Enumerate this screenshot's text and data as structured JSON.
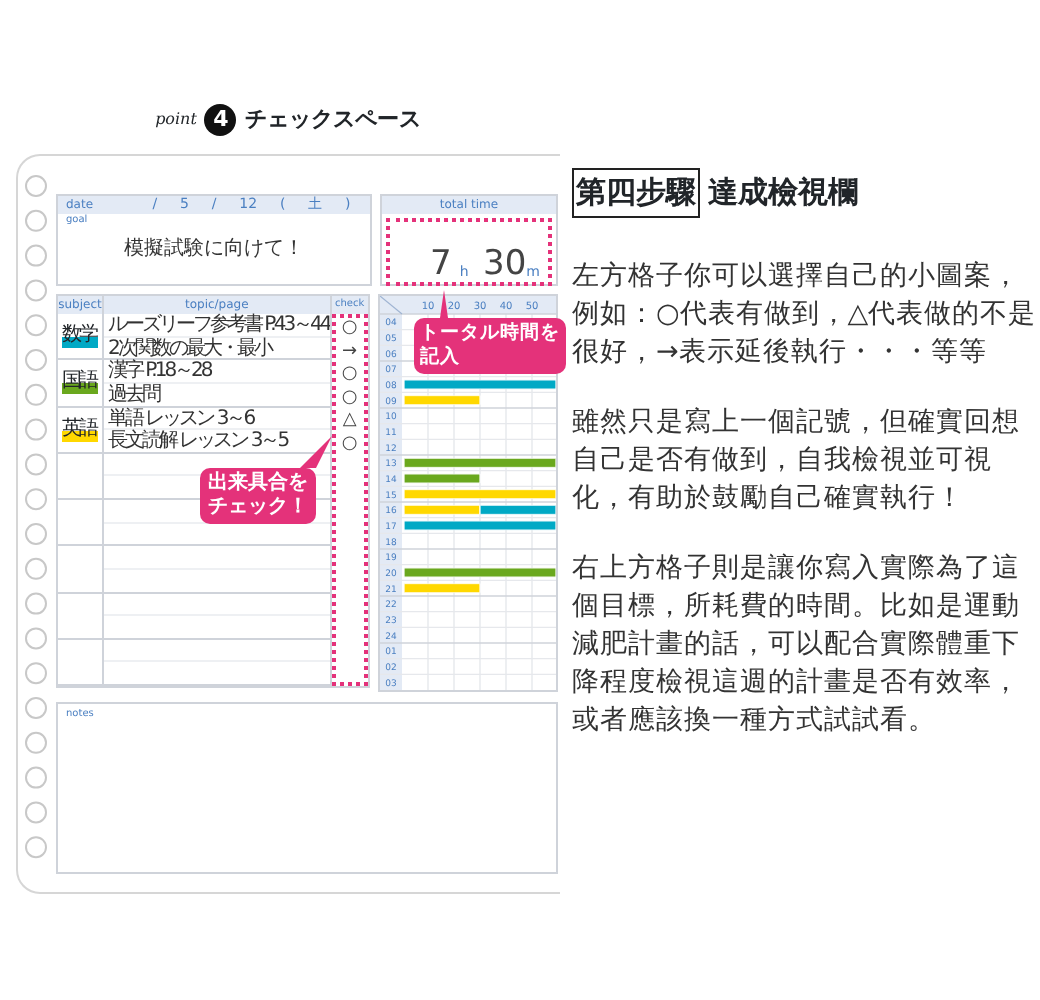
{
  "left_panel": {
    "point_label": "point",
    "point_number": "4",
    "title": "チェックスペース"
  },
  "planner": {
    "date": {
      "label": "date",
      "parts": [
        "/",
        "5",
        "/",
        "12",
        "(",
        "土",
        ")"
      ]
    },
    "goal": {
      "label": "goal",
      "text": "模擬試験に向けて！"
    },
    "total_time": {
      "label": "total time",
      "hours": "7",
      "hours_unit": "h",
      "minutes": "30",
      "minutes_unit": "m"
    },
    "subject_table": {
      "columns": [
        "subject",
        "topic/page",
        "check"
      ],
      "subjects": [
        {
          "name": "数学",
          "color": "#00a9c5",
          "topics": [
            {
              "text": "ルーズリーフ参考書 P.43～44",
              "check": "○"
            },
            {
              "text": "2次関数の最大・最小",
              "check": "→"
            }
          ]
        },
        {
          "name": "国語",
          "color": "#6aa81e",
          "topics": [
            {
              "text": "漢字 P.18～28",
              "check": "○"
            },
            {
              "text": "過去問",
              "check": "○"
            }
          ]
        },
        {
          "name": "英語",
          "color": "#ffd800",
          "topics": [
            {
              "text": "単語 レッスン 3～6",
              "check": "△"
            },
            {
              "text": "長文読解 レッスン 3～5",
              "check": "○"
            }
          ]
        }
      ]
    },
    "time_grid": {
      "minute_labels": [
        "10",
        "20",
        "30",
        "40",
        "50"
      ],
      "rows": [
        {
          "hour": "04"
        },
        {
          "hour": "05"
        },
        {
          "hour": "06"
        },
        {
          "hour": "07"
        },
        {
          "hour": "08",
          "segments": [
            {
              "color": "#00a9c5",
              "level": 1
            }
          ]
        },
        {
          "hour": "09",
          "segments": [
            {
              "color": "#ffd800",
              "level": 0.5
            }
          ]
        },
        {
          "hour": "10"
        },
        {
          "hour": "11"
        },
        {
          "hour": "12"
        },
        {
          "hour": "13",
          "segments": [
            {
              "color": "#6aa81e",
              "level": 1
            }
          ]
        },
        {
          "hour": "14",
          "segments": [
            {
              "color": "#6aa81e",
              "level": 0.5
            }
          ]
        },
        {
          "hour": "15",
          "segments": [
            {
              "color": "#ffd800",
              "level": 1
            }
          ]
        },
        {
          "hour": "16",
          "segments": [
            {
              "color": "#ffd800",
              "level": 0.5
            },
            {
              "color": "#00a9c5",
              "level": 0.5
            }
          ]
        },
        {
          "hour": "17",
          "segments": [
            {
              "color": "#00a9c5",
              "level": 1
            }
          ]
        },
        {
          "hour": "18"
        },
        {
          "hour": "19"
        },
        {
          "hour": "20",
          "segments": [
            {
              "color": "#6aa81e",
              "level": 1
            }
          ]
        },
        {
          "hour": "21",
          "segments": [
            {
              "color": "#ffd800",
              "level": 0.5
            }
          ]
        },
        {
          "hour": "22"
        },
        {
          "hour": "23"
        },
        {
          "hour": "24"
        },
        {
          "hour": "01"
        },
        {
          "hour": "02"
        },
        {
          "hour": "03"
        }
      ]
    },
    "notes": {
      "label": "notes"
    },
    "callouts": [
      {
        "lines": [
          "トータル時間を",
          "記入"
        ]
      },
      {
        "lines": [
          "出来具合を",
          "チェック！"
        ]
      }
    ]
  },
  "article": {
    "heading_box": "第四步驟",
    "heading": "達成檢視欄",
    "paragraphs": [
      "左方格子你可以選擇自己的小圖案，例如：○代表有做到，△代表做的不是很好，→表示延後執行・・・等等",
      "雖然只是寫上一個記號，但確實回想自己是否有做到，自我檢視並可視化，有助於鼓勵自己確實執行！",
      "右上方格子則是讓你寫入實際為了這個目標，所耗費的時間。比如是運動減肥計畫的話，可以配合實際體重下降程度檢視這週的計畫是否有效率，或者應該換一種方式試試看。"
    ]
  }
}
